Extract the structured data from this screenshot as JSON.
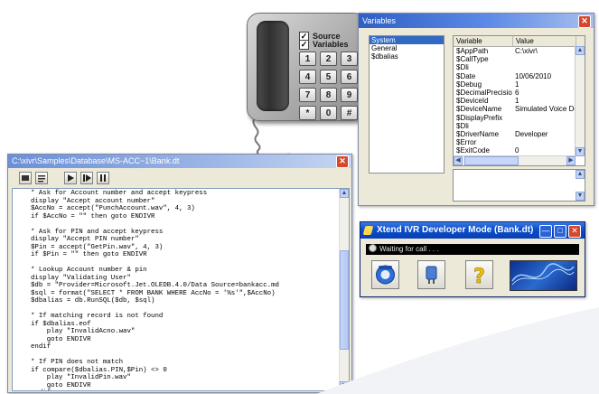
{
  "phone": {
    "options": [
      {
        "label": "Source",
        "checked": true
      },
      {
        "label": "Variables",
        "checked": true
      }
    ],
    "keys": [
      "1",
      "2",
      "3",
      "4",
      "5",
      "6",
      "7",
      "8",
      "9",
      "*",
      "0",
      "#"
    ]
  },
  "variables_window": {
    "title": "Variables",
    "tree": [
      {
        "label": "System",
        "selected": true
      },
      {
        "label": "General",
        "selected": false
      },
      {
        "label": "$dbalias",
        "selected": false
      }
    ],
    "columns": [
      "Variable",
      "Value"
    ],
    "rows": [
      [
        "$AppPath",
        "C:\\xivr\\"
      ],
      [
        "$CallType",
        ""
      ],
      [
        "$Dli",
        ""
      ],
      [
        "$Date",
        "10/06/2010"
      ],
      [
        "$Debug",
        "1"
      ],
      [
        "$DecimalPrecision",
        "6"
      ],
      [
        "$DeviceId",
        "1"
      ],
      [
        "$DeviceName",
        "Simulated Voice Devic"
      ],
      [
        "$DisplayPrefix",
        ""
      ],
      [
        "$Dli",
        ""
      ],
      [
        "$DriverName",
        "Developer"
      ],
      [
        "$Error",
        ""
      ],
      [
        "$ExitCode",
        "0"
      ]
    ]
  },
  "ivr_window": {
    "title": "Xtend IVR Developer Mode  (Bank.dt)",
    "status": "Waiting for call . . ."
  },
  "code_window": {
    "title": "C:\\xivr\\Samples\\Database\\MS-ACC~1\\Bank.dt",
    "code": "* Ask for Account number and accept keypress\ndisplay \"Accept account number\"\n$AccNo = accept(\"PunchAccount.wav\", 4, 3)\nif $AccNo = \"\" then goto ENDIVR\n\n* Ask for PIN and accept keypress\ndisplay \"Accept PIN number\"\n$Pin = accept(\"GetPin.wav\", 4, 3)\nif $Pin = \"\" then goto ENDIVR\n\n* Lookup Account number & pin\ndisplay \"Validating User\"\n$db = \"Provider=Microsoft.Jet.OLEDB.4.0/Data Source=bankacc.md\n$sql = format(\"SELECT * FROM BANK WHERE AccNo = '%s'\",$AccNo)\n$dbalias = db.RunSQL($db, $sql)\n\n* If matching record is not found\nif $dbalias.eof\n    play \"InvalidAcno.wav\"\n    goto ENDIVR\nendif\n\n* If PIN does not match\nif compare($dbalias.PIN,$Pin) <> 0\n    play \"InvalidPin.wav\"\n    goto ENDIVR\nendif"
  },
  "colors": {
    "titlebar": "#2f5fc4",
    "selection": "#316ac5",
    "close": "#d7462e"
  }
}
